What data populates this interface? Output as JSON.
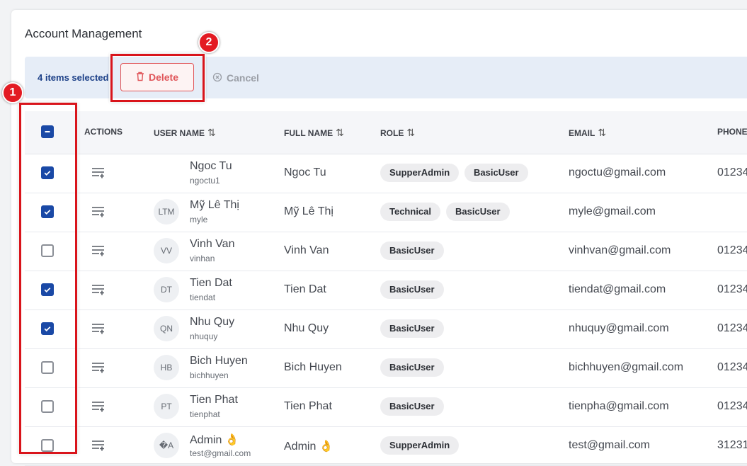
{
  "title": "Account Management",
  "selection": {
    "count_text": "4 items selected",
    "delete_label": "Delete",
    "cancel_label": "Cancel"
  },
  "columns": {
    "actions": "ACTIONS",
    "username": "USER NAME",
    "fullname": "FULL NAME",
    "role": "ROLE",
    "email": "EMAIL",
    "phone": "PHONE",
    "sort_glyph": "⇅"
  },
  "header_checkbox": "indeterminate",
  "rows": [
    {
      "checked": true,
      "avatar": "",
      "username": "Ngoc Tu",
      "login": "ngoctu1",
      "fullname": "Ngoc Tu",
      "roles": [
        "SupperAdmin",
        "BasicUser"
      ],
      "email": "ngoctu@gmail.com",
      "phone": "01234"
    },
    {
      "checked": true,
      "avatar": "LTM",
      "username": "Mỹ Lê Thị",
      "login": "myle",
      "fullname": "Mỹ Lê Thị",
      "roles": [
        "Technical",
        "BasicUser"
      ],
      "email": "myle@gmail.com",
      "phone": ""
    },
    {
      "checked": false,
      "avatar": "VV",
      "username": "Vinh Van",
      "login": "vinhan",
      "fullname": "Vinh Van",
      "roles": [
        "BasicUser"
      ],
      "email": "vinhvan@gmail.com",
      "phone": "01234"
    },
    {
      "checked": true,
      "avatar": "DT",
      "username": "Tien Dat",
      "login": "tiendat",
      "fullname": "Tien Dat",
      "roles": [
        "BasicUser"
      ],
      "email": "tiendat@gmail.com",
      "phone": "01234"
    },
    {
      "checked": true,
      "avatar": "QN",
      "username": "Nhu Quy",
      "login": "nhuquy",
      "fullname": "Nhu Quy",
      "roles": [
        "BasicUser"
      ],
      "email": "nhuquy@gmail.com",
      "phone": "01234"
    },
    {
      "checked": false,
      "avatar": "HB",
      "username": "Bich Huyen",
      "login": "bichhuyen",
      "fullname": "Bich Huyen",
      "roles": [
        "BasicUser"
      ],
      "email": "bichhuyen@gmail.com",
      "phone": "01234"
    },
    {
      "checked": false,
      "avatar": "PT",
      "username": "Tien Phat",
      "login": "tienphat",
      "fullname": "Tien Phat",
      "roles": [
        "BasicUser"
      ],
      "email": "tienpha@gmail.com",
      "phone": "01234"
    },
    {
      "checked": false,
      "avatar": "�A",
      "username": "Admin 👌",
      "login": "test@gmail.com",
      "fullname": "Admin 👌",
      "roles": [
        "SupperAdmin"
      ],
      "email": "test@gmail.com",
      "phone": "31231"
    }
  ],
  "annotations": [
    "1",
    "2"
  ],
  "colors": {
    "accent": "#1a49a6",
    "danger": "#e0565a",
    "callout": "#e31b23"
  }
}
